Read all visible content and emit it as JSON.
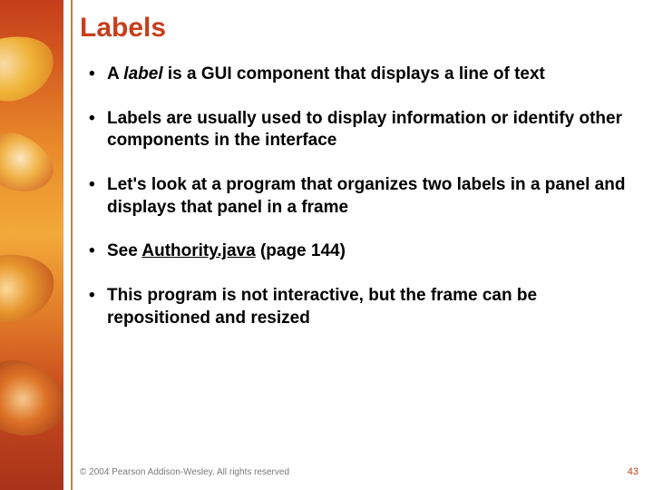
{
  "title": "Labels",
  "bullets": {
    "b1_pre": "A ",
    "b1_em": "label",
    "b1_post": " is a GUI component that displays a line of text",
    "b2": "Labels are usually used to display information or identify other components in the interface",
    "b3": "Let's look at a program that organizes two labels in a panel and displays that panel in a frame",
    "b4_pre": "See ",
    "b4_link": "Authority.java",
    "b4_post": " (page 144)",
    "b5": "This program is not interactive, but the frame can be repositioned and resized"
  },
  "footer": {
    "copyright": "© 2004 Pearson Addison-Wesley. All rights reserved",
    "page": "43"
  }
}
